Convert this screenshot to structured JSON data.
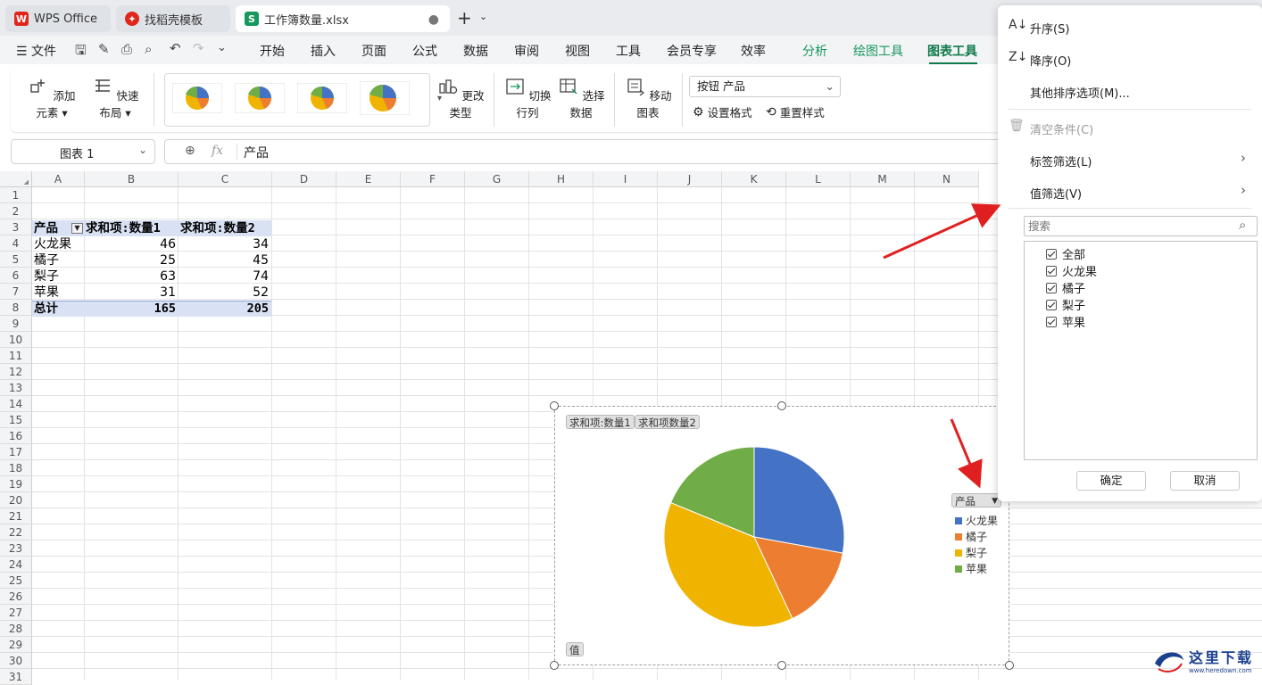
{
  "tabs": [
    {
      "label": "WPS Office"
    },
    {
      "label": "找稻壳模板"
    },
    {
      "label": "工作簿数量.xlsx"
    }
  ],
  "menu": {
    "file": "文件",
    "items": [
      "开始",
      "插入",
      "页面",
      "公式",
      "数据",
      "审阅",
      "视图",
      "工具",
      "会员专享",
      "效率",
      "分析",
      "绘图工具",
      "图表工具"
    ]
  },
  "ribbon": {
    "add_element": "添加元素",
    "quick_layout": "快速布局",
    "change_type": "更改类型",
    "switch_row_col": "切换行列",
    "select_data": "选择数据",
    "move_chart": "移动图表",
    "element_select": "按钮 产品",
    "set_format": "设置格式",
    "reset_style": "重置样式"
  },
  "formula": {
    "name_box": "图表 1",
    "fx": "fx",
    "content": "产品"
  },
  "grid": {
    "columns": [
      "A",
      "B",
      "C",
      "D",
      "E",
      "F",
      "G",
      "H",
      "I",
      "J",
      "K",
      "L",
      "M",
      "N"
    ],
    "rows": [
      "1",
      "2",
      "3",
      "4",
      "5",
      "6",
      "7",
      "8",
      "9",
      "10",
      "11",
      "12",
      "13",
      "14",
      "15",
      "16",
      "17",
      "18",
      "19",
      "20",
      "21",
      "22",
      "23",
      "24",
      "25",
      "26",
      "27",
      "28",
      "29",
      "30",
      "31"
    ]
  },
  "pivot": {
    "header": [
      "产品",
      "求和项:数量1",
      "求和项:数量2"
    ],
    "rows": [
      {
        "name": "火龙果",
        "q1": "46",
        "q2": "34"
      },
      {
        "name": "橘子",
        "q1": "25",
        "q2": "45"
      },
      {
        "name": "梨子",
        "q1": "63",
        "q2": "74"
      },
      {
        "name": "苹果",
        "q1": "31",
        "q2": "52"
      }
    ],
    "total": {
      "name": "总计",
      "q1": "165",
      "q2": "205"
    }
  },
  "chart": {
    "field_btn1": "求和项:数量1",
    "field_btn2": "求和项数量2",
    "field_product": "产品",
    "field_value": "值",
    "colors": [
      "#4472c4",
      "#ed7d31",
      "#f0b400",
      "#70ad47"
    ]
  },
  "chart_data": {
    "type": "pie",
    "categories": [
      "火龙果",
      "橘子",
      "梨子",
      "苹果"
    ],
    "values": [
      46,
      25,
      63,
      31
    ],
    "legend": "right"
  },
  "filter_panel": {
    "sort_asc": "升序(S)",
    "sort_desc": "降序(O)",
    "other_sort": "其他排序选项(M)...",
    "clear": "清空条件(C)",
    "label_filter": "标签筛选(L)",
    "value_filter": "值筛选(V)",
    "search_placeholder": "搜索",
    "items": [
      "全部",
      "火龙果",
      "橘子",
      "梨子",
      "苹果"
    ],
    "ok": "确定",
    "cancel": "取消"
  },
  "watermark": {
    "text": "这里下载",
    "url": "www.heredown.com"
  }
}
